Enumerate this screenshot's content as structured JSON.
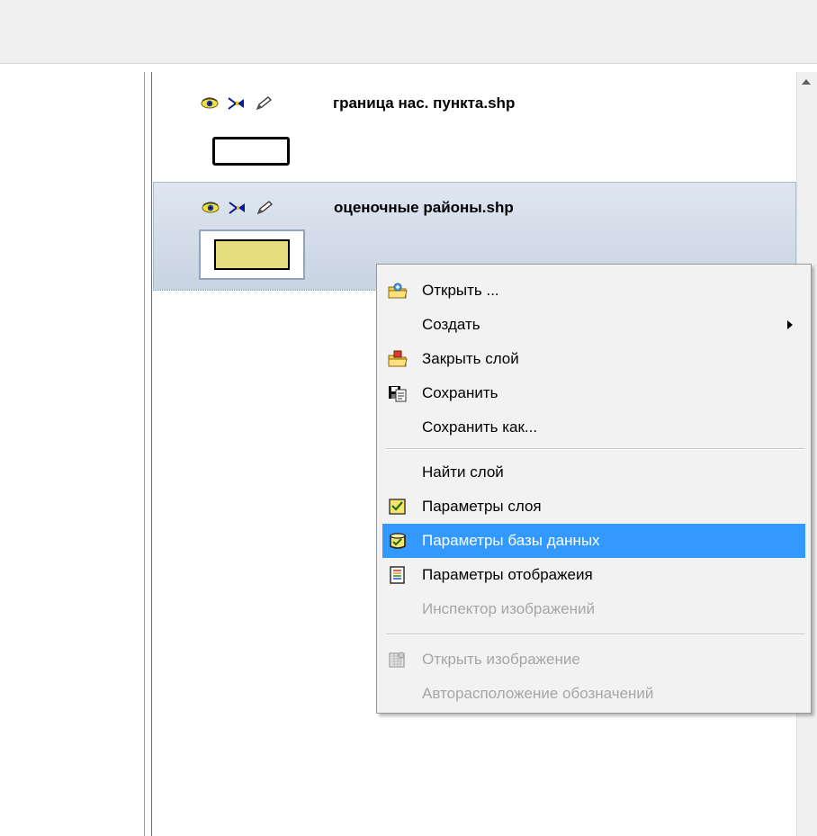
{
  "layers": [
    {
      "name": "граница нас. пункта.shp",
      "selected": false,
      "symbol_fill": "#ffffff",
      "icons": [
        "visibility-eye-icon",
        "snap-icon",
        "edit-pencil-icon"
      ]
    },
    {
      "name": "оценочные районы.shp",
      "selected": true,
      "symbol_fill": "#e8dd7e",
      "icons": [
        "visibility-eye-icon",
        "snap-icon",
        "edit-pencil-icon"
      ]
    }
  ],
  "context_menu": {
    "items": [
      {
        "label": "Открыть ...",
        "icon": "open-folder-icon",
        "disabled": false
      },
      {
        "label": "Создать",
        "icon": null,
        "disabled": false,
        "submenu": true
      },
      {
        "label": "Закрыть слой",
        "icon": "close-layer-folder-icon",
        "disabled": false
      },
      {
        "label": "Сохранить",
        "icon": "save-icon",
        "disabled": false
      },
      {
        "label": "Сохранить как...",
        "icon": null,
        "disabled": false
      },
      {
        "label": "Найти слой",
        "icon": null,
        "disabled": false
      },
      {
        "label": "Параметры слоя",
        "icon": "layer-params-icon",
        "disabled": false
      },
      {
        "label": "Параметры базы данных",
        "icon": "database-params-icon",
        "disabled": false,
        "highlighted": true
      },
      {
        "label": "Параметры отображеия",
        "icon": "display-params-icon",
        "disabled": false
      },
      {
        "label": "Инспектор изображений",
        "icon": null,
        "disabled": true
      },
      {
        "label": "Открыть изображение",
        "icon": "open-image-icon",
        "disabled": true
      },
      {
        "label": "Авторасположение обозначений",
        "icon": null,
        "disabled": true
      }
    ]
  },
  "colors": {
    "highlight": "#3399ff",
    "selected_layer_bg": "#d4dde9",
    "disabled_text": "#a6a6a6"
  }
}
